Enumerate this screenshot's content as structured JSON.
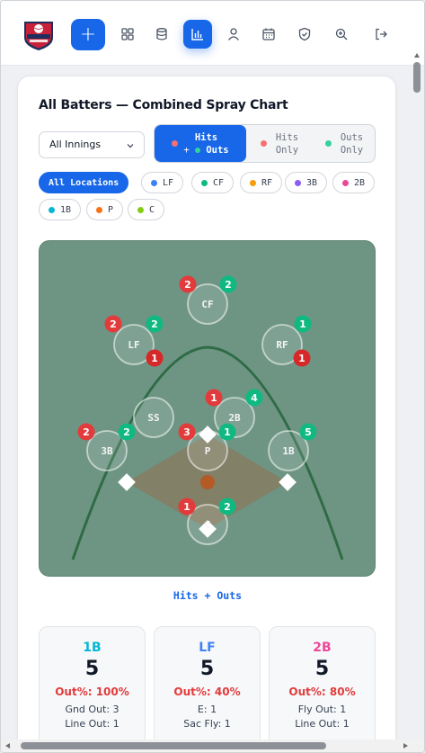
{
  "nav": {
    "add_label": "+",
    "items": [
      {
        "icon": "grid-icon"
      },
      {
        "icon": "database-icon"
      },
      {
        "icon": "bar-chart-icon",
        "active": true
      },
      {
        "icon": "user-icon"
      },
      {
        "icon": "calendar-icon"
      },
      {
        "icon": "shield-icon"
      },
      {
        "icon": "zoom-in-icon"
      },
      {
        "icon": "logout-icon"
      }
    ],
    "active_color": "#1767e8"
  },
  "spray": {
    "title": "All Batters — Combined Spray Chart",
    "innings_select": "All Innings",
    "modes": [
      {
        "label_top": "Hits",
        "label_bottom": "Outs",
        "active": true
      },
      {
        "label_top": "Hits",
        "label_bottom": "Only",
        "active": false
      },
      {
        "label_top": "Outs",
        "label_bottom": "Only",
        "active": false
      }
    ],
    "locations": [
      {
        "label": "All Locations",
        "active": true
      },
      {
        "label": "LF",
        "color": "#3b82f6"
      },
      {
        "label": "CF",
        "color": "#10b981"
      },
      {
        "label": "RF",
        "color": "#f59e0b"
      },
      {
        "label": "3B",
        "color": "#8b5cf6"
      },
      {
        "label": "2B",
        "color": "#ec4899"
      },
      {
        "label": "1B",
        "color": "#06b6d4"
      },
      {
        "label": "P",
        "color": "#f97316"
      },
      {
        "label": "C",
        "color": "#84cc16"
      }
    ],
    "field_positions": [
      {
        "pos": "CF",
        "outs": 2,
        "hits": 2
      },
      {
        "pos": "LF",
        "outs": 2,
        "hits": 2,
        "extra": 1
      },
      {
        "pos": "RF",
        "outs": null,
        "hits": 1,
        "extra": 1
      },
      {
        "pos": "SS",
        "outs": null,
        "hits": null
      },
      {
        "pos": "2B",
        "outs": 1,
        "hits": 4
      },
      {
        "pos": "3B",
        "outs": 2,
        "hits": 2
      },
      {
        "pos": "P",
        "outs": 3,
        "hits": 1
      },
      {
        "pos": "1B",
        "outs": null,
        "hits": 5
      },
      {
        "pos": "C",
        "outs": 1,
        "hits": 2
      }
    ],
    "caption": "Hits + Outs",
    "colors": {
      "field": "#6e9584",
      "out": "#e23b3b",
      "hit": "#10b981",
      "infield": "#8a7a5c"
    }
  },
  "stats": [
    {
      "pos": "1B",
      "color": "#06b6d4",
      "value": "5",
      "pct": "Out%: 100%",
      "l1": "Gnd Out: 3",
      "l2": "Line Out: 1"
    },
    {
      "pos": "LF",
      "color": "#3b82f6",
      "value": "5",
      "pct": "Out%: 40%",
      "l1": "E: 1",
      "l2": "Sac Fly: 1"
    },
    {
      "pos": "2B",
      "color": "#ec4899",
      "value": "5",
      "pct": "Out%: 80%",
      "l1": "Fly Out: 1",
      "l2": "Line Out: 1"
    }
  ]
}
